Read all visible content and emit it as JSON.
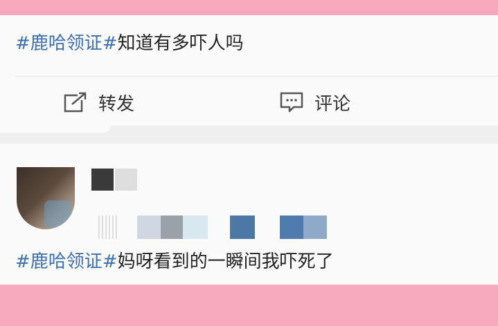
{
  "post1": {
    "hashtag": "#鹿哈领证#",
    "text": "知道有多吓人吗"
  },
  "actions": {
    "repost_label": "转发",
    "comment_label": "评论"
  },
  "post2": {
    "hashtag": "#鹿哈领证#",
    "text": "妈呀看到的一瞬间我吓死了"
  },
  "colors": {
    "accent_pink": "#f7a9bd",
    "hashtag_blue": "#3d6fb0"
  },
  "icons": {
    "repost": "repost-icon",
    "comment": "comment-icon"
  }
}
